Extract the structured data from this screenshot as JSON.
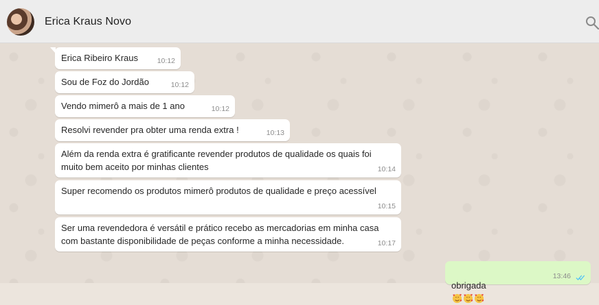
{
  "header": {
    "contact_name": "Erica Kraus Novo"
  },
  "messages": [
    {
      "text": "Erica Ribeiro Kraus",
      "time": "10:12"
    },
    {
      "text": "Sou de Foz do Jordão",
      "time": "10:12"
    },
    {
      "text": "Vendo mimerô a mais de 1 ano",
      "time": "10:12"
    },
    {
      "text": "Resolvi revender pra obter uma renda extra !",
      "time": "10:13"
    },
    {
      "text": "Além da renda extra é gratificante revender produtos de qualidade os quais foi\nmuito bem aceito por minhas clientes",
      "time": "10:14"
    },
    {
      "text": "Super recomendo os produtos mimerô produtos de qualidade e preço acessível",
      "time": "10:15"
    },
    {
      "text": "Ser uma revendedora é versátil e prático recebo as mercadorias em minha casa\ncom bastante disponibilidade de peças conforme a minha necessidade.",
      "time": "10:17"
    }
  ],
  "outgoing": {
    "text": "obrigada",
    "emojis": [
      "smiling-face-with-hearts",
      "smiling-face-with-hearts",
      "smiling-face-with-hearts"
    ],
    "time": "13:46",
    "status": "read"
  },
  "colors": {
    "incoming_bubble": "#ffffff",
    "outgoing_bubble": "#dcf8c6",
    "read_ticks": "#4fc3f7",
    "chat_background": "#e5ddd5",
    "header_background": "#ededed"
  }
}
